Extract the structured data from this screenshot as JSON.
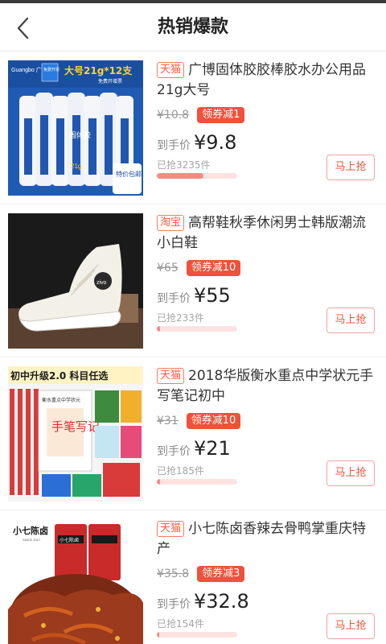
{
  "header": {
    "title": "热销爆款",
    "back_icon": "chevron-left-icon"
  },
  "accent": "#f0513a",
  "products": [
    {
      "platform": "天猫",
      "name": "广博固体胶胶棒胶水办公用品21g大号",
      "orig_price": "¥10.8",
      "coupon": "领券减1",
      "final_label": "到手价",
      "final_price": "¥9.8",
      "sold": "已抢3235件",
      "progress": 0.58,
      "buy_label": "马上抢",
      "image_text": {
        "brand": "Guangbo 广博文具",
        "badge": "免费开票",
        "headline": "大号21g*12支",
        "sub": "免费开增票",
        "stick_label": "固体胶",
        "stick_size": "21g",
        "corner": "特价包邮"
      }
    },
    {
      "platform": "淘宝",
      "name": "高帮鞋秋季休闲男士韩版潮流小白鞋",
      "orig_price": "¥65",
      "coupon": "领券减10",
      "final_label": "到手价",
      "final_price": "¥55",
      "sold": "已抢233件",
      "progress": 0.04,
      "buy_label": "马上抢",
      "image_text": {
        "logo": "zivo"
      }
    },
    {
      "platform": "天猫",
      "name": "2018华版衡水重点中学状元手写笔记初中",
      "orig_price": "¥31",
      "coupon": "领券减10",
      "final_label": "到手价",
      "final_price": "¥21",
      "sold": "已抢185件",
      "progress": 0.04,
      "buy_label": "马上抢",
      "image_text": {
        "banner": "初中升级2.0 科目任选",
        "cover_top": "衡水重点中学状元",
        "cover_title": "手笔写记"
      }
    },
    {
      "platform": "天猫",
      "name": "小七陈卤香辣去骨鸭掌重庆特产",
      "orig_price": "¥35.8",
      "coupon": "领券减3",
      "final_label": "到手价",
      "final_price": "¥32.8",
      "sold": "已抢154件",
      "progress": 0.03,
      "buy_label": "马上抢",
      "image_text": {
        "brand": "小七陈卤",
        "brand_en": "SINCE 2017",
        "pack": "小七陈卤"
      }
    }
  ]
}
